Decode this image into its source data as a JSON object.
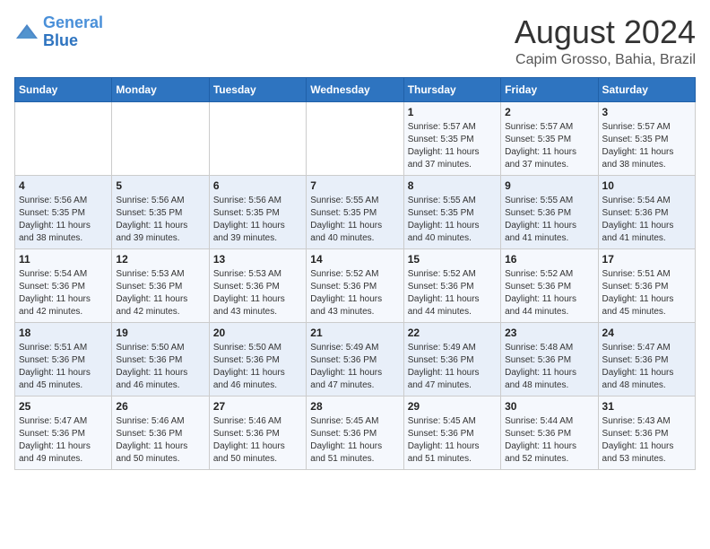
{
  "header": {
    "logo_line1": "General",
    "logo_line2": "Blue",
    "month_year": "August 2024",
    "location": "Capim Grosso, Bahia, Brazil"
  },
  "weekdays": [
    "Sunday",
    "Monday",
    "Tuesday",
    "Wednesday",
    "Thursday",
    "Friday",
    "Saturday"
  ],
  "weeks": [
    [
      {
        "day": "",
        "info": ""
      },
      {
        "day": "",
        "info": ""
      },
      {
        "day": "",
        "info": ""
      },
      {
        "day": "",
        "info": ""
      },
      {
        "day": "1",
        "info": "Sunrise: 5:57 AM\nSunset: 5:35 PM\nDaylight: 11 hours\nand 37 minutes."
      },
      {
        "day": "2",
        "info": "Sunrise: 5:57 AM\nSunset: 5:35 PM\nDaylight: 11 hours\nand 37 minutes."
      },
      {
        "day": "3",
        "info": "Sunrise: 5:57 AM\nSunset: 5:35 PM\nDaylight: 11 hours\nand 38 minutes."
      }
    ],
    [
      {
        "day": "4",
        "info": "Sunrise: 5:56 AM\nSunset: 5:35 PM\nDaylight: 11 hours\nand 38 minutes."
      },
      {
        "day": "5",
        "info": "Sunrise: 5:56 AM\nSunset: 5:35 PM\nDaylight: 11 hours\nand 39 minutes."
      },
      {
        "day": "6",
        "info": "Sunrise: 5:56 AM\nSunset: 5:35 PM\nDaylight: 11 hours\nand 39 minutes."
      },
      {
        "day": "7",
        "info": "Sunrise: 5:55 AM\nSunset: 5:35 PM\nDaylight: 11 hours\nand 40 minutes."
      },
      {
        "day": "8",
        "info": "Sunrise: 5:55 AM\nSunset: 5:35 PM\nDaylight: 11 hours\nand 40 minutes."
      },
      {
        "day": "9",
        "info": "Sunrise: 5:55 AM\nSunset: 5:36 PM\nDaylight: 11 hours\nand 41 minutes."
      },
      {
        "day": "10",
        "info": "Sunrise: 5:54 AM\nSunset: 5:36 PM\nDaylight: 11 hours\nand 41 minutes."
      }
    ],
    [
      {
        "day": "11",
        "info": "Sunrise: 5:54 AM\nSunset: 5:36 PM\nDaylight: 11 hours\nand 42 minutes."
      },
      {
        "day": "12",
        "info": "Sunrise: 5:53 AM\nSunset: 5:36 PM\nDaylight: 11 hours\nand 42 minutes."
      },
      {
        "day": "13",
        "info": "Sunrise: 5:53 AM\nSunset: 5:36 PM\nDaylight: 11 hours\nand 43 minutes."
      },
      {
        "day": "14",
        "info": "Sunrise: 5:52 AM\nSunset: 5:36 PM\nDaylight: 11 hours\nand 43 minutes."
      },
      {
        "day": "15",
        "info": "Sunrise: 5:52 AM\nSunset: 5:36 PM\nDaylight: 11 hours\nand 44 minutes."
      },
      {
        "day": "16",
        "info": "Sunrise: 5:52 AM\nSunset: 5:36 PM\nDaylight: 11 hours\nand 44 minutes."
      },
      {
        "day": "17",
        "info": "Sunrise: 5:51 AM\nSunset: 5:36 PM\nDaylight: 11 hours\nand 45 minutes."
      }
    ],
    [
      {
        "day": "18",
        "info": "Sunrise: 5:51 AM\nSunset: 5:36 PM\nDaylight: 11 hours\nand 45 minutes."
      },
      {
        "day": "19",
        "info": "Sunrise: 5:50 AM\nSunset: 5:36 PM\nDaylight: 11 hours\nand 46 minutes."
      },
      {
        "day": "20",
        "info": "Sunrise: 5:50 AM\nSunset: 5:36 PM\nDaylight: 11 hours\nand 46 minutes."
      },
      {
        "day": "21",
        "info": "Sunrise: 5:49 AM\nSunset: 5:36 PM\nDaylight: 11 hours\nand 47 minutes."
      },
      {
        "day": "22",
        "info": "Sunrise: 5:49 AM\nSunset: 5:36 PM\nDaylight: 11 hours\nand 47 minutes."
      },
      {
        "day": "23",
        "info": "Sunrise: 5:48 AM\nSunset: 5:36 PM\nDaylight: 11 hours\nand 48 minutes."
      },
      {
        "day": "24",
        "info": "Sunrise: 5:47 AM\nSunset: 5:36 PM\nDaylight: 11 hours\nand 48 minutes."
      }
    ],
    [
      {
        "day": "25",
        "info": "Sunrise: 5:47 AM\nSunset: 5:36 PM\nDaylight: 11 hours\nand 49 minutes."
      },
      {
        "day": "26",
        "info": "Sunrise: 5:46 AM\nSunset: 5:36 PM\nDaylight: 11 hours\nand 50 minutes."
      },
      {
        "day": "27",
        "info": "Sunrise: 5:46 AM\nSunset: 5:36 PM\nDaylight: 11 hours\nand 50 minutes."
      },
      {
        "day": "28",
        "info": "Sunrise: 5:45 AM\nSunset: 5:36 PM\nDaylight: 11 hours\nand 51 minutes."
      },
      {
        "day": "29",
        "info": "Sunrise: 5:45 AM\nSunset: 5:36 PM\nDaylight: 11 hours\nand 51 minutes."
      },
      {
        "day": "30",
        "info": "Sunrise: 5:44 AM\nSunset: 5:36 PM\nDaylight: 11 hours\nand 52 minutes."
      },
      {
        "day": "31",
        "info": "Sunrise: 5:43 AM\nSunset: 5:36 PM\nDaylight: 11 hours\nand 53 minutes."
      }
    ]
  ]
}
